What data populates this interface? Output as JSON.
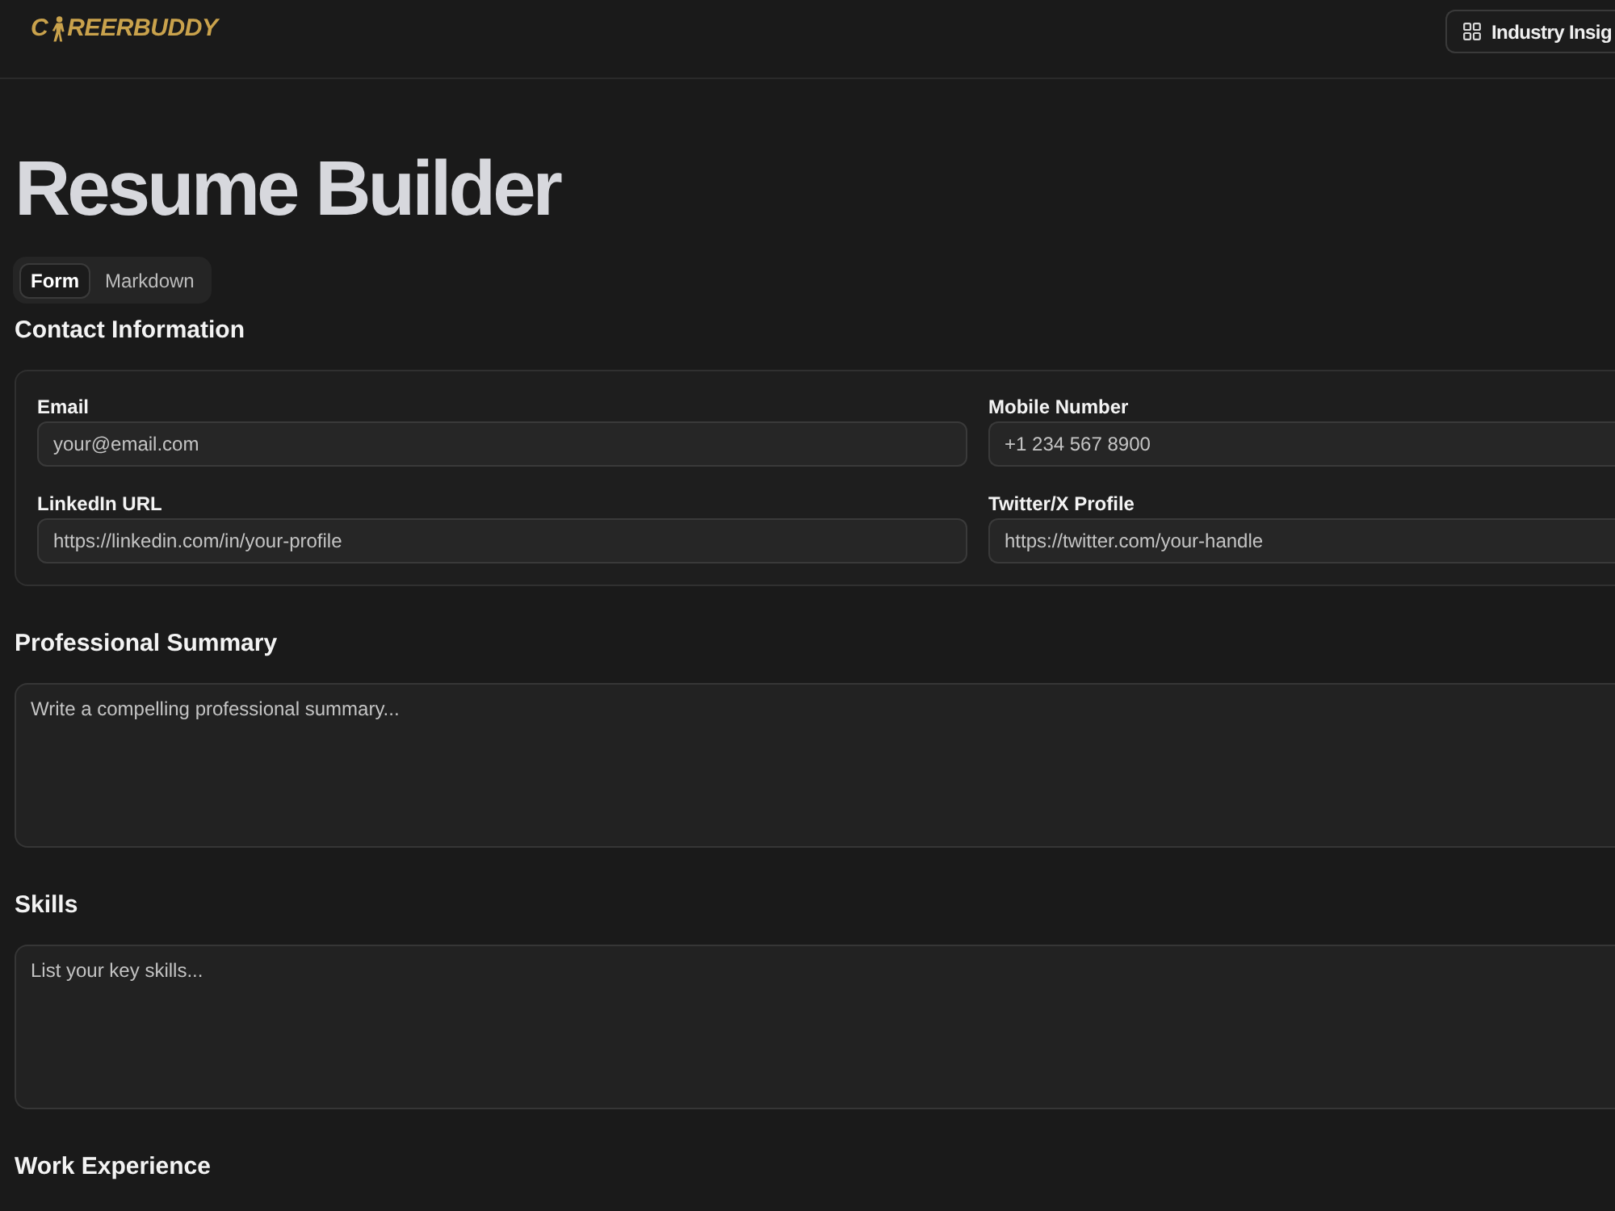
{
  "header": {
    "logo": {
      "prefix": "C",
      "suffix": "REERBUDDY"
    },
    "actions": [
      {
        "label": "Industry Insig"
      }
    ]
  },
  "page": {
    "title": "Resume Builder"
  },
  "tabs": [
    {
      "label": "Form",
      "selected": true
    },
    {
      "label": "Markdown",
      "selected": false
    }
  ],
  "sections": [
    {
      "heading": "Contact Information",
      "kind": "fields",
      "fields": [
        {
          "label": "Email",
          "placeholder": "your@email.com"
        },
        {
          "label": "Mobile Number",
          "placeholder": "+1 234 567 8900"
        },
        {
          "label": "LinkedIn URL",
          "placeholder": "https://linkedin.com/in/your-profile"
        },
        {
          "label": "Twitter/X Profile",
          "placeholder": "https://twitter.com/your-handle"
        }
      ]
    },
    {
      "heading": "Professional Summary",
      "kind": "textarea",
      "placeholder": "Write a compelling professional summary..."
    },
    {
      "heading": "Skills",
      "kind": "textarea",
      "placeholder": "List your key skills..."
    },
    {
      "heading": "Work Experience",
      "kind": "heading"
    }
  ]
}
